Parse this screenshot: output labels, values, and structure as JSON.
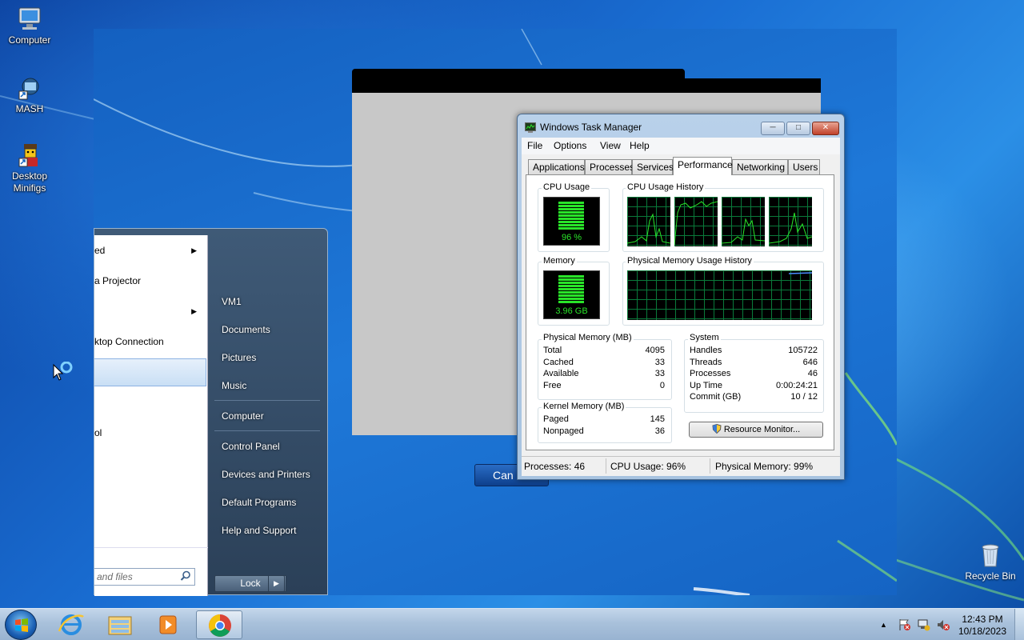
{
  "desktop": {
    "icons": [
      {
        "label": "Computer"
      },
      {
        "label": "MASH"
      },
      {
        "label": "Desktop Minifigs"
      }
    ],
    "recycle_bin": {
      "label": "Recycle Bin"
    }
  },
  "background_window": {
    "cancel_label": "Can"
  },
  "start_menu": {
    "left_items": [
      {
        "label": "ed",
        "has_submenu": true
      },
      {
        "label": "a Projector",
        "has_submenu": false
      },
      {
        "label": "",
        "has_submenu": true
      },
      {
        "label": "ktop Connection",
        "has_submenu": false
      },
      {
        "label": "",
        "has_submenu": false
      },
      {
        "label": "ol",
        "has_submenu": false
      }
    ],
    "search_placeholder": "and files",
    "right_items": [
      {
        "label": "VM1"
      },
      {
        "label": "Documents"
      },
      {
        "label": "Pictures"
      },
      {
        "label": "Music"
      },
      {
        "label": "Computer"
      },
      {
        "label": "Control Panel"
      },
      {
        "label": "Devices and Printers"
      },
      {
        "label": "Default Programs"
      },
      {
        "label": "Help and Support"
      }
    ],
    "lock_label": "Lock"
  },
  "task_manager": {
    "title": "Windows Task Manager",
    "menu": [
      "File",
      "Options",
      "View",
      "Help"
    ],
    "tabs": [
      "Applications",
      "Processes",
      "Services",
      "Performance",
      "Networking",
      "Users"
    ],
    "active_tab": "Performance",
    "cpu_usage": {
      "label": "CPU Usage",
      "value": "96 %",
      "fraction": 0.96
    },
    "cpu_history": {
      "label": "CPU Usage History"
    },
    "memory": {
      "label": "Memory",
      "value": "3.96 GB",
      "fraction": 0.99
    },
    "memory_history": {
      "label": "Physical Memory Usage History"
    },
    "physical_memory": {
      "label": "Physical Memory (MB)",
      "rows": [
        {
          "k": "Total",
          "v": "4095"
        },
        {
          "k": "Cached",
          "v": "33"
        },
        {
          "k": "Available",
          "v": "33"
        },
        {
          "k": "Free",
          "v": "0"
        }
      ]
    },
    "kernel_memory": {
      "label": "Kernel Memory (MB)",
      "rows": [
        {
          "k": "Paged",
          "v": "145"
        },
        {
          "k": "Nonpaged",
          "v": "36"
        }
      ]
    },
    "system": {
      "label": "System",
      "rows": [
        {
          "k": "Handles",
          "v": "105722"
        },
        {
          "k": "Threads",
          "v": "646"
        },
        {
          "k": "Processes",
          "v": "46"
        },
        {
          "k": "Up Time",
          "v": "0:00:24:21"
        },
        {
          "k": "Commit (GB)",
          "v": "10 / 12"
        }
      ]
    },
    "resource_monitor_label": "Resource Monitor...",
    "status": {
      "processes": "Processes: 46",
      "cpu": "CPU Usage: 96%",
      "memory": "Physical Memory: 99%"
    }
  },
  "taskbar": {
    "clock_time": "12:43 PM",
    "clock_date": "10/18/2023",
    "pinned": [
      "internet-explorer-icon",
      "windows-explorer-icon",
      "media-player-icon",
      "chrome-icon"
    ]
  },
  "colors": {
    "meter_green": "#29e529",
    "graph_grid": "#0a7a3a",
    "taskbar": "#a9c1db"
  }
}
